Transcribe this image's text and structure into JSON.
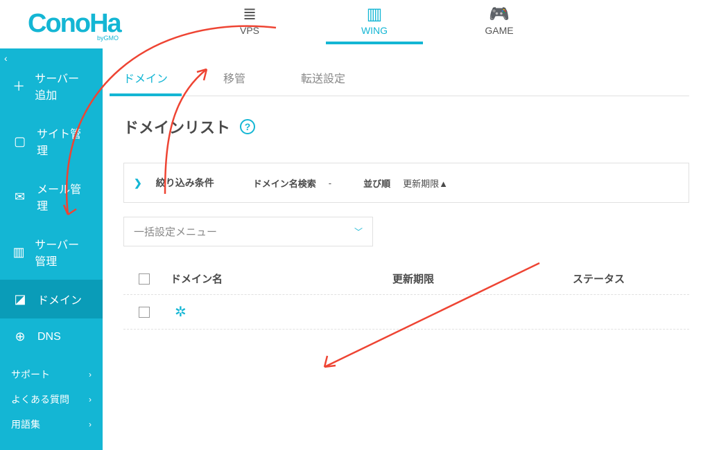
{
  "logo": {
    "main": "ConoHa",
    "sub": "byGMO"
  },
  "topTabs": [
    {
      "label": "VPS",
      "icon": "≣",
      "active": false
    },
    {
      "label": "WING",
      "icon": "▥",
      "active": true
    },
    {
      "label": "GAME",
      "icon": "🎮",
      "active": false
    }
  ],
  "sidebar": {
    "collapse": "‹",
    "items": [
      {
        "icon": "＋",
        "label": "サーバー追加",
        "name": "add-server"
      },
      {
        "icon": "▢",
        "label": "サイト管理",
        "name": "site-manage"
      },
      {
        "icon": "✉",
        "label": "メール管理",
        "name": "mail-manage"
      },
      {
        "icon": "▥",
        "label": "サーバー管理",
        "name": "server-manage"
      },
      {
        "icon": "◪",
        "label": "ドメイン",
        "name": "domain",
        "active": true
      },
      {
        "icon": "⊕",
        "label": "DNS",
        "name": "dns"
      }
    ],
    "subs": [
      {
        "label": "サポート"
      },
      {
        "label": "よくある質問"
      },
      {
        "label": "用語集"
      }
    ]
  },
  "subtabs": [
    {
      "label": "ドメイン",
      "active": true
    },
    {
      "label": "移管"
    },
    {
      "label": "転送設定"
    }
  ],
  "page": {
    "title": "ドメインリスト",
    "help": "?"
  },
  "filter": {
    "toggle": "❯",
    "title": "絞り込み条件",
    "searchLabel": "ドメイン名検索",
    "searchValue": "-",
    "sortLabel": "並び順",
    "sortValue": "更新期限▲"
  },
  "bulk": {
    "placeholder": "一括設定メニュー"
  },
  "table": {
    "headers": {
      "name": "ドメイン名",
      "expiry": "更新期限",
      "status": "ステータス"
    }
  }
}
